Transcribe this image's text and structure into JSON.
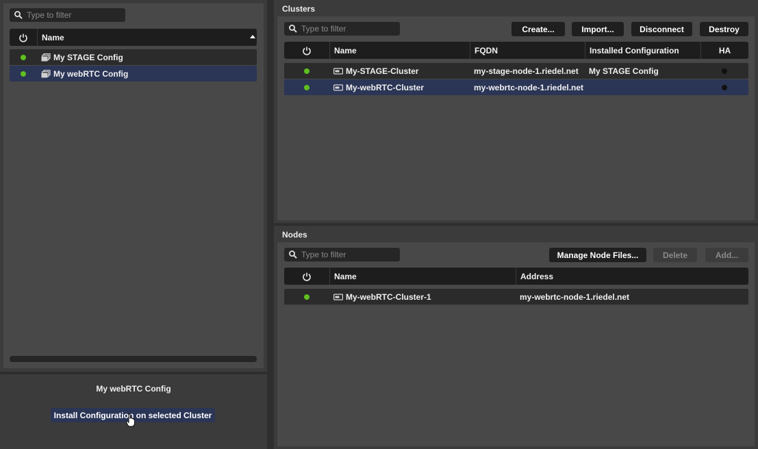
{
  "left": {
    "filter_placeholder": "Type to filter",
    "columns": {
      "name": "Name"
    },
    "configs": [
      {
        "name": "My STAGE Config"
      },
      {
        "name": "My webRTC Config"
      }
    ],
    "details": {
      "selected_name": "My webRTC Config",
      "install_button": "Install Configuration on selected Cluster"
    }
  },
  "clusters": {
    "title": "Clusters",
    "filter_placeholder": "Type to filter",
    "buttons": {
      "create": "Create...",
      "import": "Import...",
      "disconnect": "Disconnect",
      "destroy": "Destroy"
    },
    "columns": {
      "name": "Name",
      "fqdn": "FQDN",
      "installed": "Installed Configuration",
      "ha": "HA"
    },
    "rows": [
      {
        "name": "My-STAGE-Cluster",
        "fqdn": "my-stage-node-1.riedel.net",
        "installed": "My STAGE Config"
      },
      {
        "name": "My-webRTC-Cluster",
        "fqdn": "my-webrtc-node-1.riedel.net",
        "installed": ""
      }
    ]
  },
  "nodes": {
    "title": "Nodes",
    "filter_placeholder": "Type to filter",
    "buttons": {
      "manage": "Manage Node Files...",
      "delete": "Delete",
      "add": "Add..."
    },
    "columns": {
      "name": "Name",
      "address": "Address"
    },
    "rows": [
      {
        "name": "My-webRTC-Cluster-1",
        "address": "my-webrtc-node-1.riedel.net"
      }
    ]
  },
  "colors": {
    "status_online": "#5fbf1f",
    "selection": "#2b3556",
    "install_button": "#2b3556"
  }
}
